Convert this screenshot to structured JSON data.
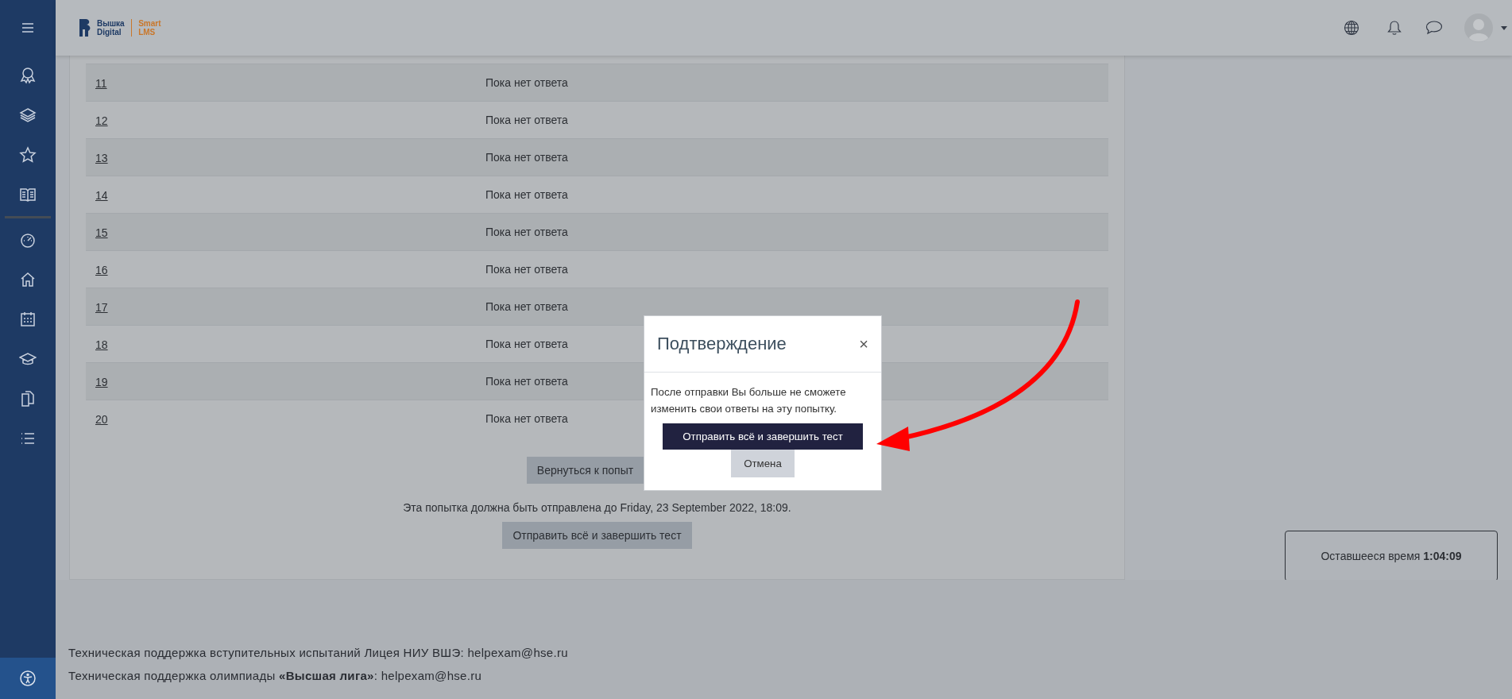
{
  "header": {
    "logo": {
      "brand_line_1": "Вышка",
      "brand_line_2": "Digital",
      "product_line_1": "Smart",
      "product_line_2": "LMS"
    }
  },
  "summary": {
    "rows": [
      {
        "number": "11",
        "status": "Пока нет ответа"
      },
      {
        "number": "12",
        "status": "Пока нет ответа"
      },
      {
        "number": "13",
        "status": "Пока нет ответа"
      },
      {
        "number": "14",
        "status": "Пока нет ответа"
      },
      {
        "number": "15",
        "status": "Пока нет ответа"
      },
      {
        "number": "16",
        "status": "Пока нет ответа"
      },
      {
        "number": "17",
        "status": "Пока нет ответа"
      },
      {
        "number": "18",
        "status": "Пока нет ответа"
      },
      {
        "number": "19",
        "status": "Пока нет ответа"
      },
      {
        "number": "20",
        "status": "Пока нет ответа"
      }
    ],
    "return_button": "Вернуться к попыт",
    "deadline": "Эта попытка должна быть отправлена до Friday, 23 September 2022, 18:09.",
    "submit_button": "Отправить всё и завершить тест"
  },
  "timer": {
    "label": "Оставшееся время",
    "value": "1:04:09"
  },
  "modal": {
    "title": "Подтверждение",
    "close": "×",
    "message": "После отправки Вы больше не сможете изменить свои ответы на эту попытку.",
    "confirm_button": "Отправить всё и завершить тест",
    "cancel_button": "Отмена"
  },
  "footer": {
    "lines": [
      "Техническая поддержка вступительных испытаний Лицея НИУ ВШЭ: helpexam@hse.ru",
      "Техническая поддержка олимпиады **«Высшая лига»**: helpexam@hse.ru"
    ]
  }
}
